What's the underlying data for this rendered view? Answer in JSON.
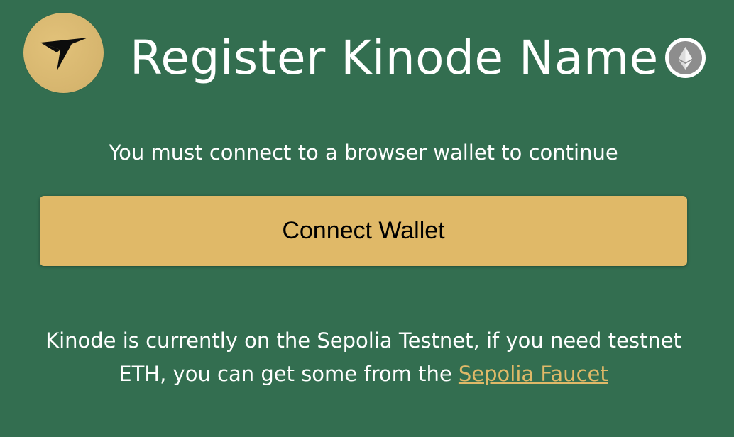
{
  "header": {
    "title": "Register Kinode Name"
  },
  "main": {
    "prompt": "You must connect to a browser wallet to continue",
    "connect_button_label": "Connect Wallet",
    "notice_text": "Kinode is currently on the Sepolia Testnet, if you need testnet ETH, you can get some from the ",
    "faucet_link_label": "Sepolia Faucet"
  },
  "icons": {
    "logo": "kinode-logo",
    "network": "ethereum-icon"
  },
  "colors": {
    "background": "#336e50",
    "accent": "#e0b968",
    "text": "#ffffff"
  }
}
